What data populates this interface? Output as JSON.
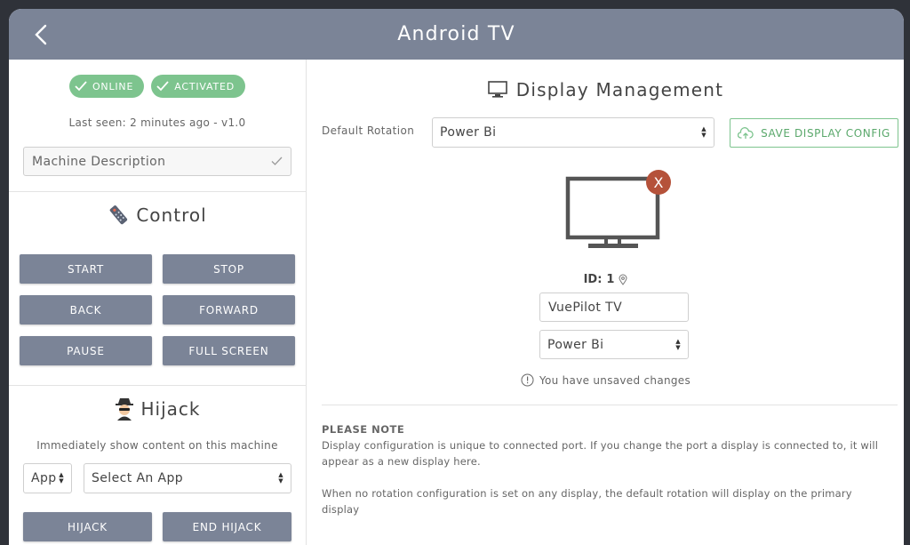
{
  "titlebar": {
    "title": "Android TV"
  },
  "status": {
    "badges": [
      "ONLINE",
      "ACTIVATED"
    ],
    "last_seen": "Last seen: 2 minutes ago - v1.0",
    "badge_color": "#7dc48e"
  },
  "description": {
    "placeholder": "Machine Description"
  },
  "control": {
    "title": "Control",
    "buttons": [
      "START",
      "STOP",
      "BACK",
      "FORWARD",
      "PAUSE",
      "FULL SCREEN"
    ]
  },
  "hijack": {
    "title": "Hijack",
    "caption": "Immediately show content on this machine",
    "type_select": "App",
    "app_select": "Select An App",
    "buttons": [
      "HIJACK",
      "END HIJACK"
    ]
  },
  "display": {
    "title": "Display Management",
    "rotation_label": "Default Rotation",
    "rotation_value": "Power Bi",
    "save_label": "SAVE DISPLAY CONFIG",
    "remove_mark": "X",
    "id_label": "ID:",
    "id_value": "1",
    "name_value": "VuePilot TV",
    "display_rotation": "Power Bi",
    "unsaved": "You have unsaved changes"
  },
  "note": {
    "title": "PLEASE NOTE",
    "line1": "Display configuration is unique to connected port. If you change the port a display is connected to, it will appear as a new display here.",
    "line2": "When no rotation configuration is set on any display, the default rotation will display on the primary display"
  },
  "colors": {
    "header": "#7b8497",
    "accent_green": "#7dc48e",
    "remove_red": "#b5523a"
  }
}
